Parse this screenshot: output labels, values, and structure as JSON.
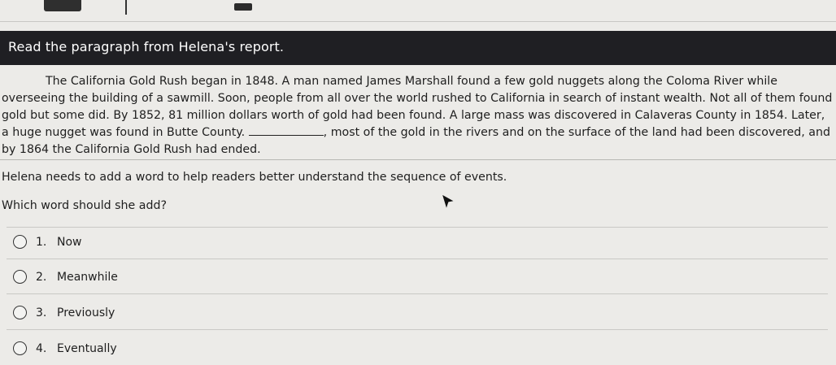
{
  "header": {
    "title": "Read the paragraph from Helena's report."
  },
  "passage": {
    "sentence_before_blank": "The California Gold Rush began in 1848. A man named James Marshall found a few gold nuggets along the Coloma River while overseeing the building of a sawmill. Soon, people from all over the world rushed to California in search of instant wealth. Not all of them found gold but some did. By 1852, 81 million dollars worth of gold had been found. A large mass was discovered in Calaveras County in 1854. Later, a huge nugget was found in Butte County.",
    "sentence_after_blank": ", most of the gold in the rivers and on the surface of the land had been discovered, and by 1864 the California Gold Rush had ended."
  },
  "question": {
    "instruction": "Helena needs to add a word to help readers better understand the sequence of events.",
    "prompt": "Which word should she add?"
  },
  "options": [
    {
      "number": "1.",
      "label": "Now",
      "selected": false
    },
    {
      "number": "2.",
      "label": "Meanwhile",
      "selected": false
    },
    {
      "number": "3.",
      "label": "Previously",
      "selected": false
    },
    {
      "number": "4.",
      "label": "Eventually",
      "selected": false
    }
  ]
}
